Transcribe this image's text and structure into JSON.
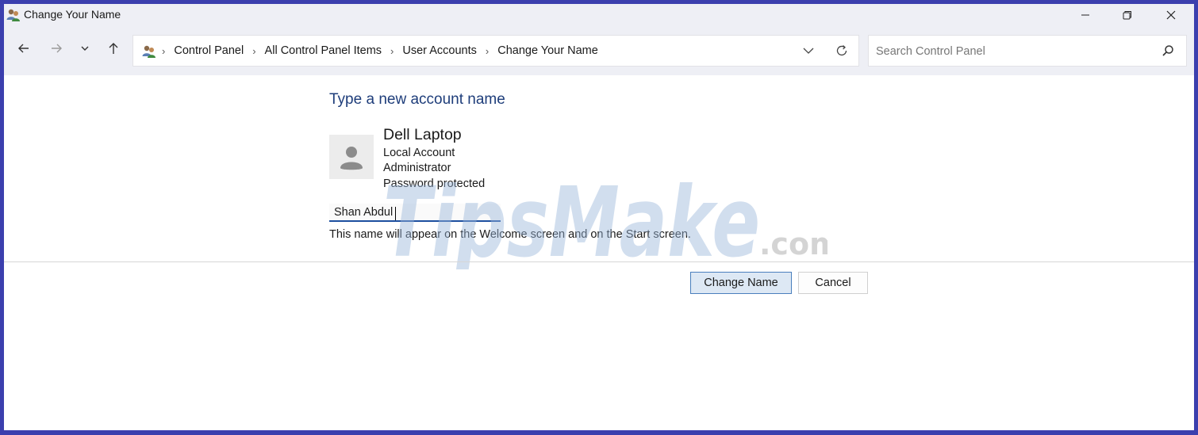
{
  "window": {
    "title": "Change Your Name"
  },
  "nav": {
    "breadcrumb": [
      "Control Panel",
      "All Control Panel Items",
      "User Accounts",
      "Change Your Name"
    ],
    "search_placeholder": "Search Control Panel"
  },
  "content": {
    "heading": "Type a new account name",
    "account": {
      "name": "Dell Laptop",
      "type": "Local Account",
      "role": "Administrator",
      "status": "Password protected"
    },
    "new_name_value": "Shan Abdul",
    "help_text": "This name will appear on the Welcome screen and on the Start screen."
  },
  "buttons": {
    "primary": "Change Name",
    "cancel": "Cancel"
  },
  "watermark": {
    "brand": "TipsMake",
    "suffix": ".com"
  },
  "colors": {
    "frame": "#3b3fae",
    "chrome": "#eeeff5",
    "heading": "#1e3d7a",
    "accent": "#1d4fa0"
  }
}
